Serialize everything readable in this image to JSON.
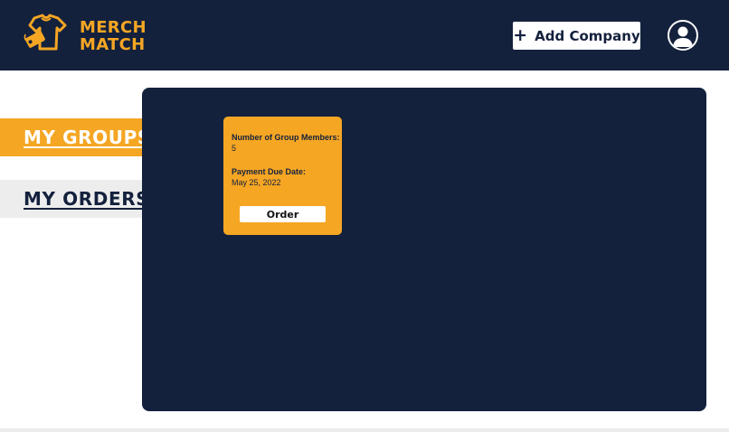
{
  "brand": {
    "line1": "MERCH",
    "line2": "MATCH",
    "color": "#f5a623"
  },
  "header": {
    "add_company_label": "Add Company",
    "add_icon": "plus-icon",
    "profile_icon": "user-icon",
    "background": "#14213d"
  },
  "sidebar": {
    "items": [
      {
        "label": "MY GROUPS",
        "active": true
      },
      {
        "label": "MY ORDERS",
        "active": false
      }
    ]
  },
  "group_card": {
    "members_label": "Number of Group Members:",
    "members_value": "5",
    "due_label": "Payment Due Date:",
    "due_value": "May 25, 2022",
    "order_label": "Order"
  }
}
